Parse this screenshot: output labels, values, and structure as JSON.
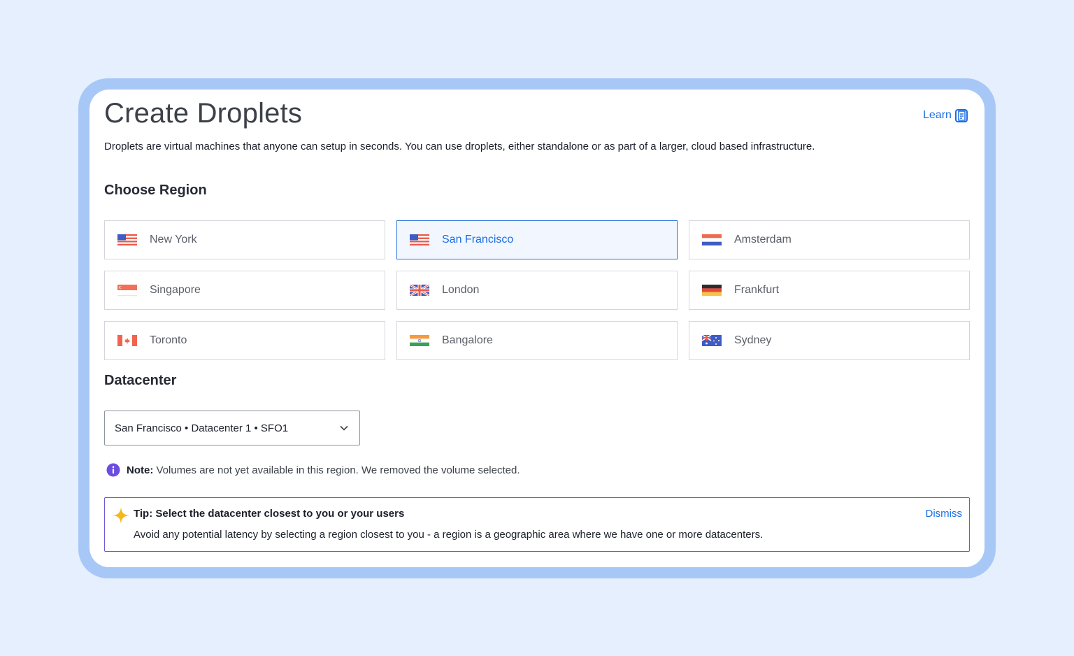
{
  "page": {
    "title": "Create Droplets",
    "learn_label": "Learn",
    "description": "Droplets are virtual machines that anyone can setup in seconds. You can use droplets, either standalone or as part of a larger, cloud based infrastructure."
  },
  "region_section": {
    "heading": "Choose Region",
    "selected": "San Francisco",
    "regions": [
      {
        "label": "New York",
        "flag": "us-flag-icon"
      },
      {
        "label": "San Francisco",
        "flag": "us-flag-icon"
      },
      {
        "label": "Amsterdam",
        "flag": "netherlands-flag-icon"
      },
      {
        "label": "Singapore",
        "flag": "singapore-flag-icon"
      },
      {
        "label": "London",
        "flag": "uk-flag-icon"
      },
      {
        "label": "Frankfurt",
        "flag": "germany-flag-icon"
      },
      {
        "label": "Toronto",
        "flag": "canada-flag-icon"
      },
      {
        "label": "Bangalore",
        "flag": "india-flag-icon"
      },
      {
        "label": "Sydney",
        "flag": "australia-flag-icon"
      }
    ]
  },
  "datacenter_section": {
    "heading": "Datacenter",
    "selected_value": "San Francisco • Datacenter 1 • SFO1"
  },
  "note": {
    "label": "Note:",
    "text": " Volumes are not yet available in this region. We removed the volume selected."
  },
  "tip": {
    "title": "Tip: Select the datacenter closest to you or your users",
    "body": "Avoid any potential latency by selecting a region closest to you - a region is a geographic area where we have one or more datacenters.",
    "dismiss_label": "Dismiss"
  },
  "colors": {
    "background": "#e6effe",
    "frame": "#a7c8f7",
    "accent": "#1a6ee3",
    "tip_border": "#6d5ad6",
    "info_icon": "#6b4de0",
    "star_icon": "#f5b81c"
  }
}
